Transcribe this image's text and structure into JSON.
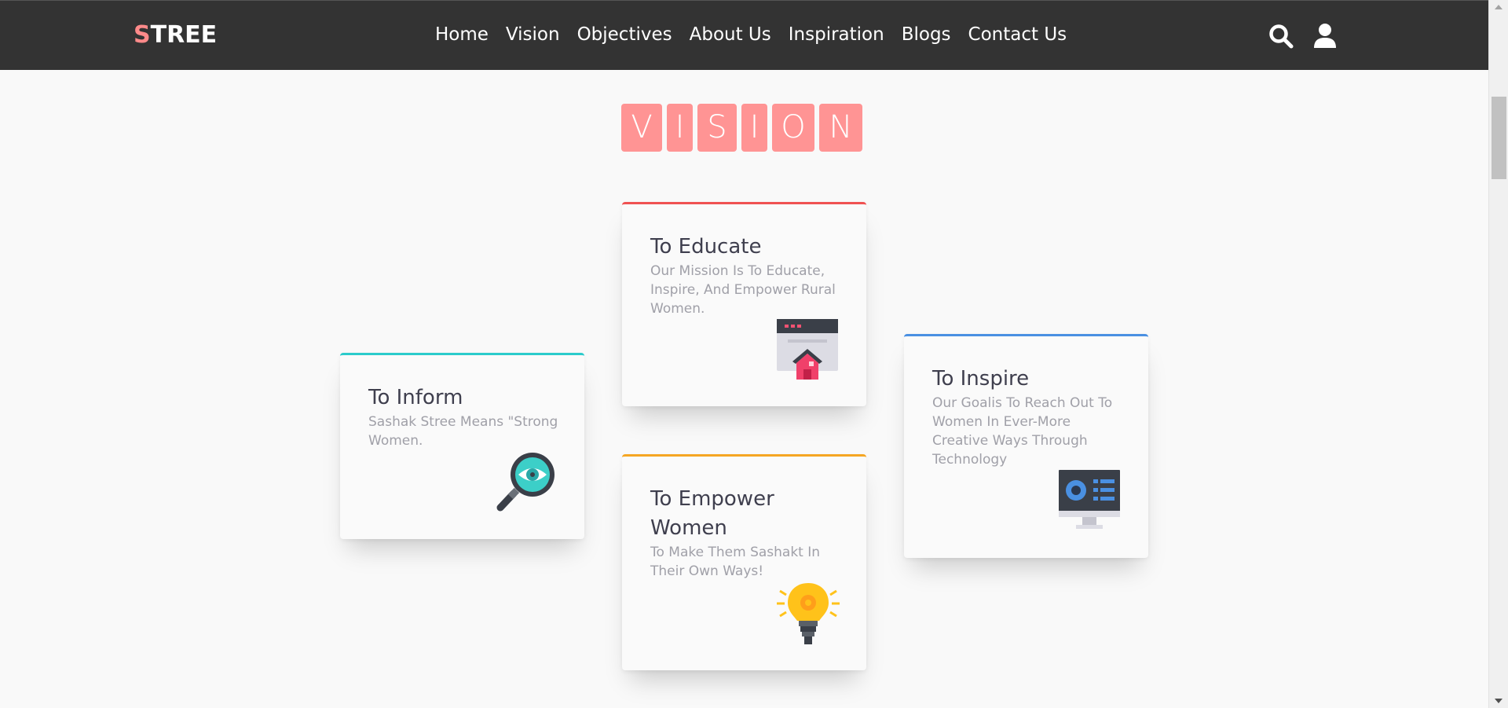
{
  "header": {
    "logo_first": "S",
    "logo_rest": "TREE",
    "nav": [
      "Home",
      "Vision",
      "Objectives",
      "About Us",
      "Inspiration",
      "Blogs",
      "Contact Us"
    ],
    "search_icon": "search-icon",
    "user_icon": "user-icon"
  },
  "vision": {
    "letters": [
      "V",
      "I",
      "S",
      "I",
      "O",
      "N"
    ]
  },
  "cards": {
    "educate": {
      "title": "To Educate",
      "text": "Our Mission Is To Educate, Inspire, And Empower Rural Women.",
      "icon": "browser-home-icon",
      "accent": "#f05252"
    },
    "inform": {
      "title": "To Inform",
      "text": "Sashak Stree Means \"Strong Women.",
      "icon": "magnifier-eye-icon",
      "accent": "#2bcbcb"
    },
    "inspire": {
      "title": "To Inspire",
      "text": "Our Goalis To Reach Out To Women In Ever-More Creative Ways Through Technology",
      "icon": "monitor-icon",
      "accent": "#4a90e2"
    },
    "empower": {
      "title": "To Empower Women",
      "text": "To Make Them Sashakt In Their Own Ways!",
      "icon": "lightbulb-icon",
      "accent": "#f5a623"
    }
  },
  "colors": {
    "header_bg": "#333333",
    "logo_accent": "#ff8a8a",
    "vision_tile": "#ff9494",
    "page_bg": "#f9f9f9"
  }
}
